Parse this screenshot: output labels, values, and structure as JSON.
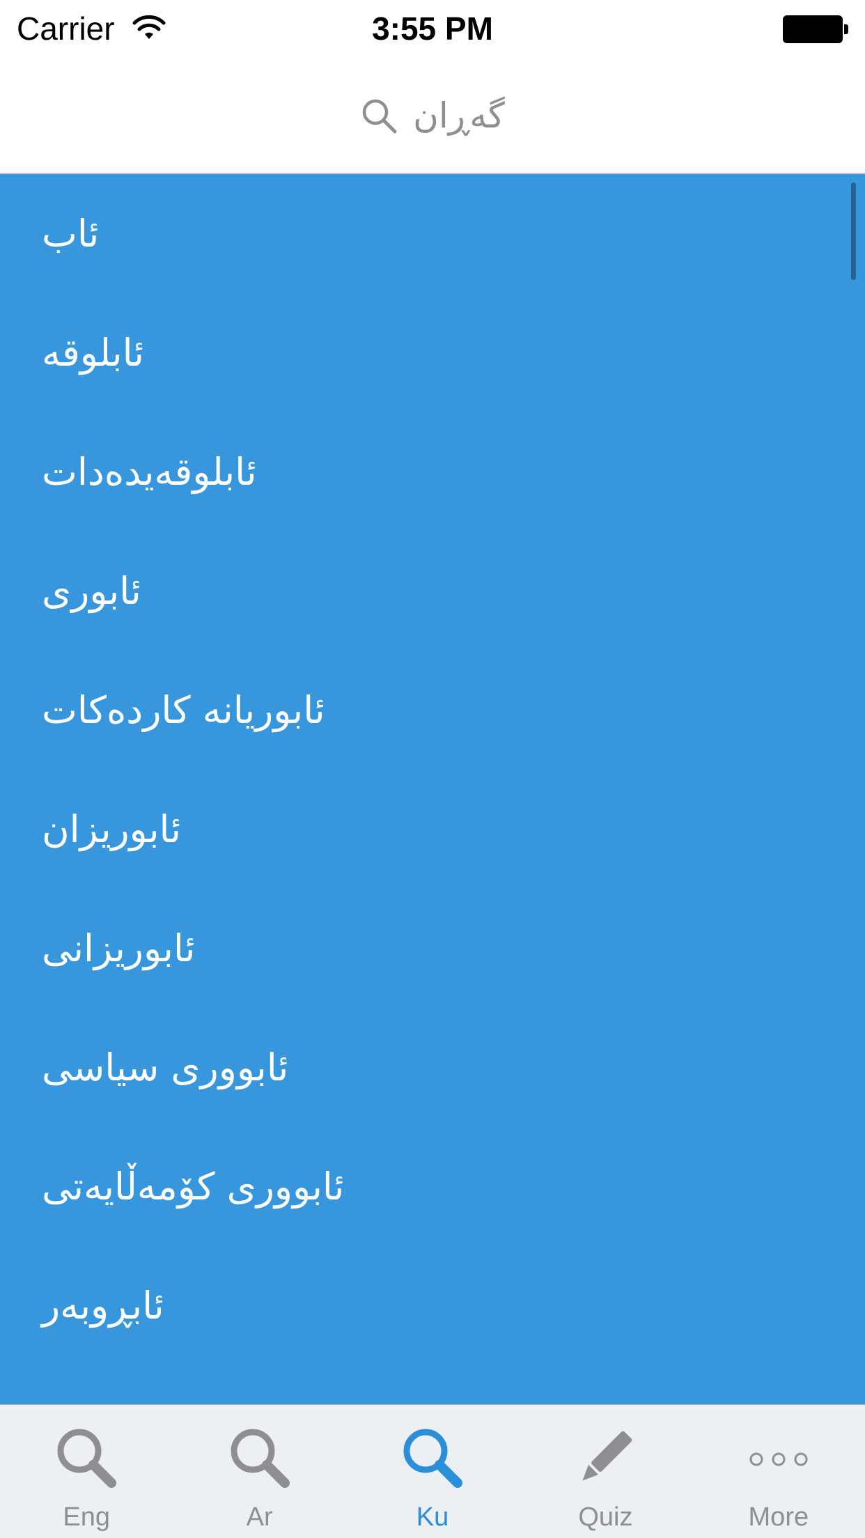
{
  "status_bar": {
    "carrier": "Carrier",
    "time": "3:55 PM"
  },
  "search": {
    "placeholder": "گەڕان",
    "icon": "search-icon"
  },
  "colors": {
    "list_background": "#3897dc",
    "tab_active": "#2a8fd8",
    "tab_inactive": "#8e8e93",
    "tab_bar_background": "#edf0f2"
  },
  "list": {
    "items": [
      {
        "label": "ئاب"
      },
      {
        "label": "ئابلوقه"
      },
      {
        "label": "ئابلوقەیدەدات"
      },
      {
        "label": "ئابوری"
      },
      {
        "label": "ئابوریانه كاردەكات"
      },
      {
        "label": "ئابوریزان"
      },
      {
        "label": "ئابوریزانی"
      },
      {
        "label": "ئابووری سیاسی"
      },
      {
        "label": "ئابووری كۆمەڵایەتی"
      },
      {
        "label": "ئابڕوبەر"
      }
    ]
  },
  "tab_bar": {
    "tabs": [
      {
        "label": "Eng",
        "icon": "search-icon",
        "active": false
      },
      {
        "label": "Ar",
        "icon": "search-icon",
        "active": false
      },
      {
        "label": "Ku",
        "icon": "search-icon",
        "active": true
      },
      {
        "label": "Quiz",
        "icon": "pencil-icon",
        "active": false
      },
      {
        "label": "More",
        "icon": "more-dots-icon",
        "active": false
      }
    ]
  }
}
